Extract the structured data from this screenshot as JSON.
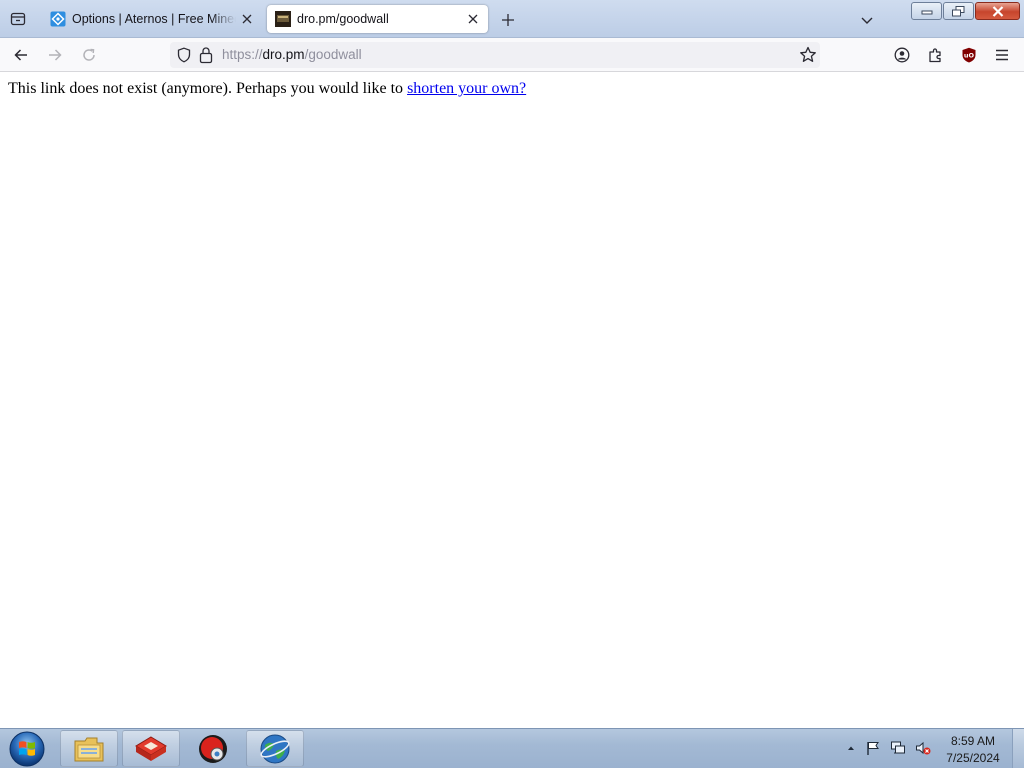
{
  "browser": {
    "tabs": [
      {
        "title": "Options | Aternos | Free Minecraft Server",
        "active": false
      },
      {
        "title": "dro.pm/goodwall",
        "active": true
      }
    ],
    "url": {
      "scheme": "https://",
      "host": "dro.pm",
      "path": "/goodwall"
    }
  },
  "page": {
    "message": "This link does not exist (anymore). Perhaps you would like to ",
    "link_text": "shorten your own?"
  },
  "taskbar": {
    "items": [
      "start-orb",
      "file-explorer",
      "app-red-box",
      "app-red-circle",
      "app-globe"
    ],
    "clock": {
      "time": "8:59 AM",
      "date": "7/25/2024"
    }
  },
  "colors": {
    "link": "#0000ee",
    "tabstrip": "#c4d3ea",
    "taskbar": "#a3b9d4"
  }
}
